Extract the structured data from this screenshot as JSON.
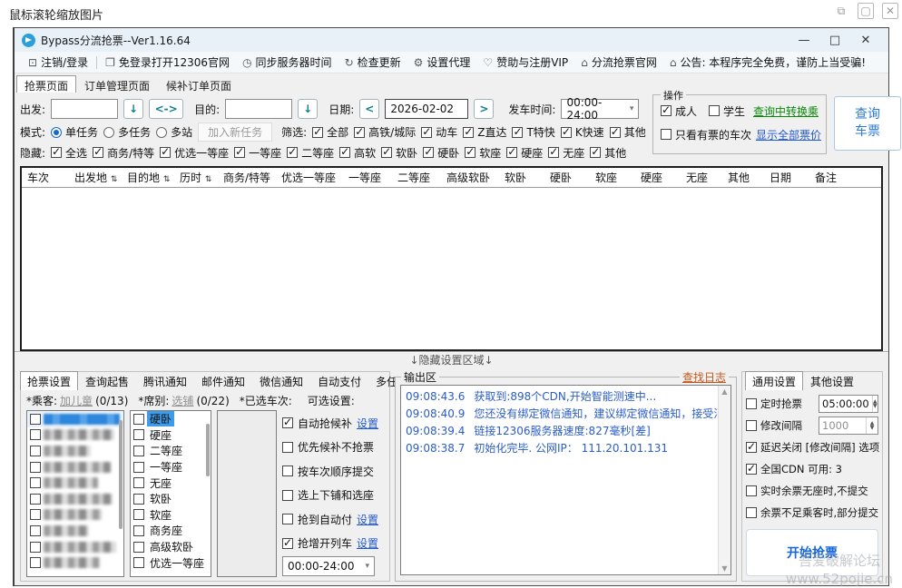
{
  "outer": {
    "title": "鼠标滚轮缩放图片"
  },
  "titlebar": {
    "title": "Bypass分流抢票--Ver1.16.64",
    "minimize": "—",
    "maximize": "□",
    "close": "✕"
  },
  "toolbar": {
    "items": [
      {
        "icon": "monitor-icon",
        "label": "注销/登录"
      },
      {
        "icon": "window-icon",
        "label": "免登录打开12306官网"
      },
      {
        "icon": "clock-icon",
        "label": "同步服务器时间"
      },
      {
        "icon": "refresh-icon",
        "label": "检查更新"
      },
      {
        "icon": "gear-icon",
        "label": "设置代理"
      },
      {
        "icon": "heart-icon",
        "label": "赞助与注册VIP"
      },
      {
        "icon": "home-icon",
        "label": "分流抢票官网"
      },
      {
        "icon": "announce-icon",
        "label": "公告: 本程序完全免费，谨防上当受骗!"
      }
    ]
  },
  "main_tabs": [
    "抢票页面",
    "订单管理页面",
    "候补订单页面"
  ],
  "query": {
    "from_label": "出发:",
    "to_label": "目的:",
    "date_label": "日期:",
    "date_value": "2026-02-02",
    "date_prev": "<",
    "date_next": ">",
    "drop_arrow": "↓",
    "swap_label": "<->",
    "time_label": "发车时间:",
    "time_value": "00:00-24:00",
    "search_line1": "查询",
    "search_line2": "车票"
  },
  "ops": {
    "legend": "操作",
    "adult": "成人",
    "student": "学生",
    "transfer_link": "查询中转换乘",
    "only_ticket": "只看有票的车次",
    "all_price_link": "显示全部票价"
  },
  "mode": {
    "label": "模式:",
    "options": [
      "单任务",
      "多任务",
      "多站"
    ],
    "add_task": "加入新任务"
  },
  "filter": {
    "label": "筛选:",
    "items": [
      "全部",
      "高铁/城际",
      "动车",
      "Z直达",
      "T特快",
      "K快速",
      "其他"
    ]
  },
  "hide": {
    "label": "隐藏:",
    "items": [
      "全选",
      "商务/特等",
      "优选一等座",
      "一等座",
      "二等座",
      "高软",
      "软卧",
      "硬卧",
      "软座",
      "硬座",
      "无座",
      "其他"
    ]
  },
  "table": {
    "columns": [
      "车次",
      "出发地",
      "目的地",
      "历时",
      "商务/特等",
      "优选一等座",
      "一等座",
      "二等座",
      "高级软卧",
      "软卧",
      "硬卧",
      "软座",
      "硬座",
      "无座",
      "其他",
      "日期",
      "备注"
    ]
  },
  "divider_text": "↓隐藏设置区域↓",
  "settings_tabs": [
    "抢票设置",
    "查询起售",
    "腾讯通知",
    "邮件通知",
    "微信通知",
    "自动支付",
    "多任务设置"
  ],
  "passenger": {
    "label": "*乘客:",
    "link": "加儿童",
    "count": "(0/13)"
  },
  "seat": {
    "label": "*席别:",
    "link": "选铺",
    "count": "(0/22)",
    "items": [
      "硬卧",
      "硬座",
      "二等座",
      "一等座",
      "无座",
      "软卧",
      "软座",
      "商务座",
      "高级软卧",
      "优选一等座"
    ],
    "selected": "硬卧"
  },
  "selected_trains_label": "*已选车次:",
  "optional": {
    "label": "可选设置:",
    "items": [
      {
        "label": "自动抢候补",
        "link": "设置"
      },
      {
        "label": "优先候补不抢票",
        "link": ""
      },
      {
        "label": "按车次顺序提交",
        "link": ""
      },
      {
        "label": "选上下铺和选座",
        "link": ""
      },
      {
        "label": "抢到自动付",
        "link": "设置"
      },
      {
        "label": "抢增开列车",
        "link": "设置"
      }
    ],
    "time_value": "00:00-24:00"
  },
  "output": {
    "legend": "输出区",
    "find_log": "查找日志",
    "lines": [
      {
        "time": "09:08:43.6",
        "text": "获取到:898个CDN,开始智能测速中..."
      },
      {
        "time": "09:08:40.9",
        "text": "您还没有绑定微信通知，建议绑定微信通知，接受消息。"
      },
      {
        "time": "09:08:39.4",
        "text": "链接12306服务器速度:827毫秒[差]"
      },
      {
        "time": "09:08:38.7",
        "text": "初始化完毕. 公网IP： 111.20.101.131"
      }
    ]
  },
  "general": {
    "tabs": [
      "通用设置",
      "其他设置"
    ],
    "timed_label": "定时抢票",
    "timed_value": "05:00:00",
    "interval_label": "修改间隔",
    "interval_value": "1000",
    "delay_label": "延迟关闭 [修改间隔] 选项",
    "cdn_label": "全国CDN  可用: 3",
    "no_seat_label": "实时余票无座时,不提交",
    "partial_label": "余票不足乘客时,部分提交",
    "start_button": "开始抢票"
  },
  "watermark": {
    "line1": "吾爱破解论坛",
    "line2": "www.52pojie.cn"
  }
}
